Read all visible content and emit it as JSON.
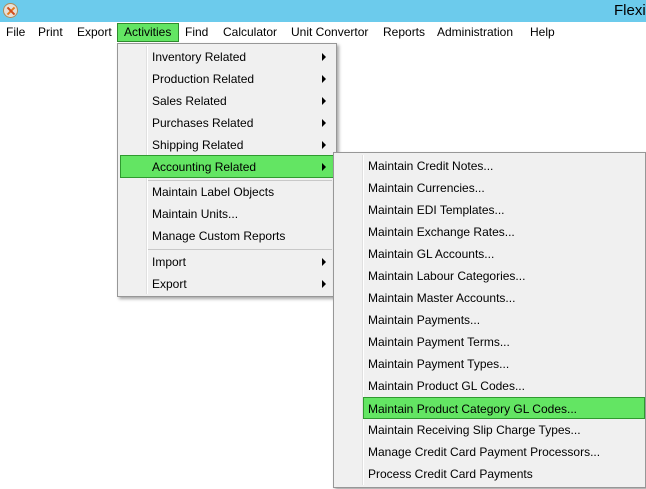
{
  "window": {
    "title": "Flexi"
  },
  "menubar": {
    "items": [
      "File",
      "Print",
      "Export",
      "Activities",
      "Find",
      "Calculator",
      "Unit Convertor",
      "Reports",
      "Administration",
      "Help"
    ]
  },
  "activities_menu": {
    "items": [
      "Inventory Related",
      "Production Related",
      "Sales Related",
      "Purchases Related",
      "Shipping Related",
      "Accounting Related",
      "Maintain Label Objects",
      "Maintain Units...",
      "Manage Custom Reports",
      "Import",
      "Export"
    ]
  },
  "accounting_menu": {
    "items": [
      "Maintain Credit Notes...",
      "Maintain Currencies...",
      "Maintain EDI Templates...",
      "Maintain Exchange Rates...",
      "Maintain GL Accounts...",
      "Maintain Labour Categories...",
      "Maintain Master Accounts...",
      "Maintain Payments...",
      "Maintain Payment Terms...",
      "Maintain Payment Types...",
      "Maintain Product GL Codes...",
      "Maintain Product Category GL Codes...",
      "Maintain Receiving Slip Charge Types...",
      "Manage Credit Card Payment Processors...",
      "Process Credit Card Payments"
    ]
  },
  "colors": {
    "titlebar": "#6ccbec",
    "highlight": "#63e563",
    "menu_bg": "#f0f0f0"
  }
}
